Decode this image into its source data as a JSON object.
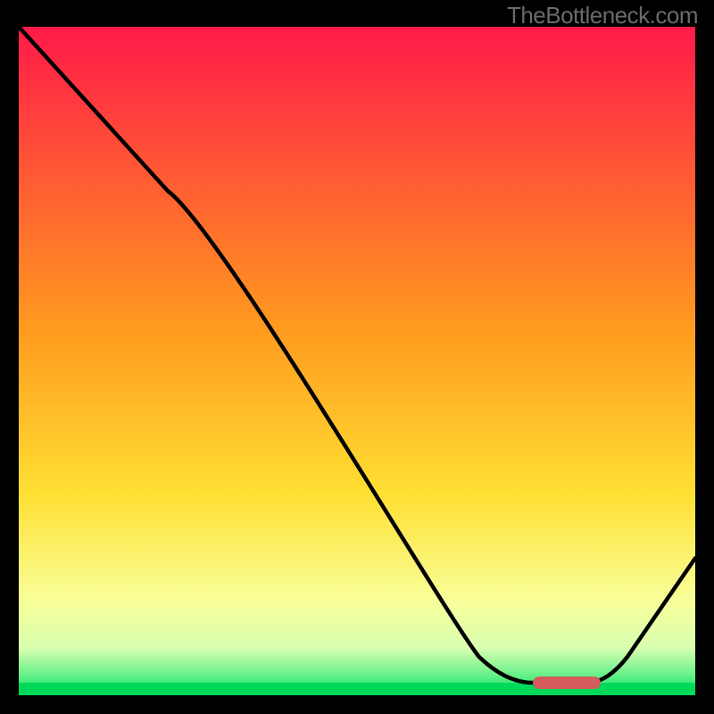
{
  "watermark": "TheBottleneck.com",
  "chart_data": {
    "type": "line",
    "title": "",
    "xlabel": "",
    "ylabel": "",
    "xlim": [
      0,
      100
    ],
    "ylim": [
      0,
      100
    ],
    "x": [
      0,
      22,
      68,
      76,
      84,
      90,
      100
    ],
    "values": [
      100,
      75,
      4,
      0,
      0,
      4,
      19
    ],
    "optimal_zone": {
      "x_start": 76,
      "x_end": 86
    },
    "note": "y ~ bottleneck severity; curve drops from 100 to a flat minimum near x≈76–86 then rises; green band at the bottom marks the optimal (low-bottleneck) region"
  },
  "colors": {
    "grad_top": "#ff1a49",
    "grad_mid": "#ffca00",
    "grad_low": "#f8ff9a",
    "grad_green": "#00e060",
    "curve": "#000000",
    "marker": "#d45c5c",
    "border": "#000000"
  }
}
